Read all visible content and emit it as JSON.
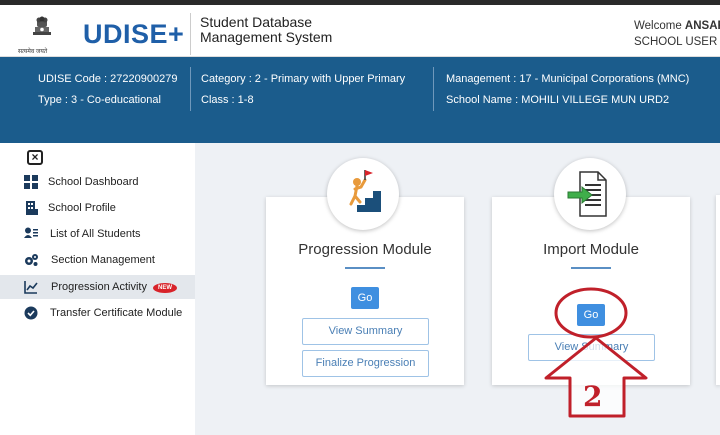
{
  "header": {
    "logo_text": "UDISE+",
    "emblem_caption": "सत्यमेव जयते",
    "title_line1": "Student Database",
    "title_line2": "Management System",
    "welcome_prefix": "Welcome",
    "welcome_user": "ANSAR",
    "user_role": "SCHOOL USER"
  },
  "school_info": {
    "udise_code": "UDISE Code : 27220900279",
    "type": "Type : 3 - Co-educational",
    "category": "Category : 2 - Primary with Upper Primary",
    "class_range": "Class : 1-8",
    "management": "Management : 17 - Municipal Corporations (MNC)",
    "school_name": "School Name : MOHILI VILLEGE MUN URD2"
  },
  "sidebar": {
    "close_label": "×",
    "items": [
      {
        "label": "School Dashboard",
        "icon": "dashboard-icon"
      },
      {
        "label": "School Profile",
        "icon": "building-icon"
      },
      {
        "label": "List of All Students",
        "icon": "students-list-icon"
      },
      {
        "label": "Section Management",
        "icon": "cogs-icon"
      },
      {
        "label": "Progression Activity",
        "icon": "chart-line-icon",
        "badge": "NEW",
        "active": true
      },
      {
        "label": "Transfer Certificate Module",
        "icon": "shield-check-icon"
      }
    ]
  },
  "modules": [
    {
      "title": "Progression Module",
      "go_label": "Go",
      "view_summary_label": "View Summary",
      "finalize_label": "Finalize Progression",
      "icon": "climbing-stairs-icon"
    },
    {
      "title": "Import Module",
      "go_label": "Go",
      "view_summary_label": "View Summary",
      "icon": "document-import-icon"
    }
  ],
  "annotation": {
    "step_number": "2",
    "color": "#c0202a"
  },
  "colors": {
    "primary_blue": "#1f5fa8",
    "info_bar": "#1b5c8c",
    "go_button": "#3f8fe0",
    "new_badge": "#d8232a"
  }
}
